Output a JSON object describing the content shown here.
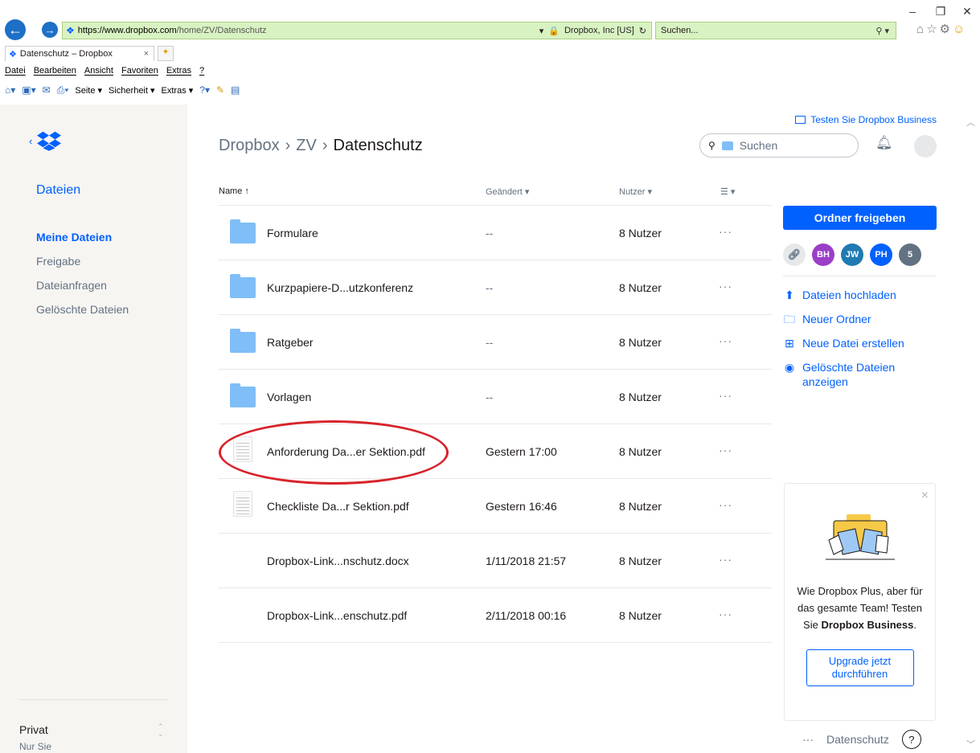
{
  "browser": {
    "url_host": "https://www.dropbox.com",
    "url_path": "/home/ZV/Datenschutz",
    "site_identity": "Dropbox, Inc [US]",
    "search_placeholder": "Suchen...",
    "tab_title": "Datenschutz – Dropbox",
    "menu": [
      "Datei",
      "Bearbeiten",
      "Ansicht",
      "Favoriten",
      "Extras",
      "?"
    ],
    "commands": {
      "seite": "Seite ▾",
      "sicherheit": "Sicherheit ▾",
      "extras": "Extras ▾"
    }
  },
  "sidebar": {
    "files_title": "Dateien",
    "items": [
      {
        "label": "Meine Dateien"
      },
      {
        "label": "Freigabe"
      },
      {
        "label": "Dateianfragen"
      },
      {
        "label": "Gelöschte Dateien"
      }
    ],
    "account": {
      "title": "Privat",
      "subtitle": "Nur Sie"
    }
  },
  "header": {
    "business_link": "Testen Sie Dropbox Business",
    "breadcrumb": {
      "root": "Dropbox",
      "mid": "ZV",
      "current": "Datenschutz"
    },
    "search_placeholder": "Suchen"
  },
  "table": {
    "columns": {
      "name": "Name",
      "modified": "Geändert",
      "users": "Nutzer"
    },
    "rows": [
      {
        "name": "Formulare",
        "modified": "--",
        "users": "8 Nutzer",
        "type": "folder"
      },
      {
        "name": "Kurzpapiere-D...utzkonferenz",
        "modified": "--",
        "users": "8 Nutzer",
        "type": "folder"
      },
      {
        "name": "Ratgeber",
        "modified": "--",
        "users": "8 Nutzer",
        "type": "folder"
      },
      {
        "name": "Vorlagen",
        "modified": "--",
        "users": "8 Nutzer",
        "type": "folder"
      },
      {
        "name": "Anforderung Da...er Sektion.pdf",
        "modified": "Gestern 17:00",
        "users": "8 Nutzer",
        "type": "pdf"
      },
      {
        "name": "Checkliste Da...r Sektion.pdf",
        "modified": "Gestern 16:46",
        "users": "8 Nutzer",
        "type": "pdf"
      },
      {
        "name": "Dropbox-Link...nschutz.docx",
        "modified": "1/11/2018 21:57",
        "users": "8 Nutzer",
        "type": "docx"
      },
      {
        "name": "Dropbox-Link...enschutz.pdf",
        "modified": "2/11/2018 00:16",
        "users": "8 Nutzer",
        "type": "pdf"
      }
    ],
    "more_label": "···"
  },
  "right_panel": {
    "share_button": "Ordner freigeben",
    "members": [
      "BH",
      "JW",
      "PH",
      "5"
    ],
    "actions": [
      {
        "label": "Dateien hochladen",
        "icon": "upload-icon"
      },
      {
        "label": "Neuer Ordner",
        "icon": "folder-outline-icon"
      },
      {
        "label": "Neue Datei erstellen",
        "icon": "new-file-icon"
      },
      {
        "label": "Gelöschte Dateien anzeigen",
        "icon": "eye-icon"
      }
    ]
  },
  "promo": {
    "text_1": "Wie Dropbox Plus, aber für das gesamte Team! Testen Sie",
    "text_bold": "Dropbox Business",
    "text_end": ".",
    "button": "Upgrade jetzt durchführen"
  },
  "footer": {
    "more": "···",
    "folder_name": "Datenschutz",
    "help": "?"
  },
  "colors": {
    "accent": "#0061fe",
    "highlight": "#d8232a",
    "folder": "#7fbef7"
  }
}
